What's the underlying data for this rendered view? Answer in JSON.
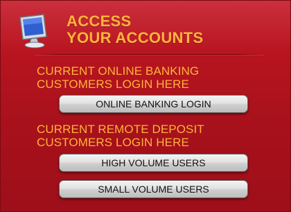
{
  "header": {
    "title_line1": "ACCESS",
    "title_line2": "YOUR ACCOUNTS",
    "icon": "computer-monitor-icon"
  },
  "online_banking": {
    "text_line1": "CURRENT ONLINE BANKING",
    "text_line2": "CUSTOMERS LOGIN HERE",
    "button_label": "ONLINE BANKING LOGIN"
  },
  "remote_deposit": {
    "text_line1": "CURRENT REMOTE DEPOSIT",
    "text_line2": "CUSTOMERS LOGIN HERE",
    "buttons": [
      {
        "label": "HIGH VOLUME USERS"
      },
      {
        "label": "SMALL VOLUME USERS"
      }
    ]
  },
  "colors": {
    "panel_red": "#b5141f",
    "heading_orange": "#ffb43a",
    "button_gray": "#d6d6d6"
  }
}
